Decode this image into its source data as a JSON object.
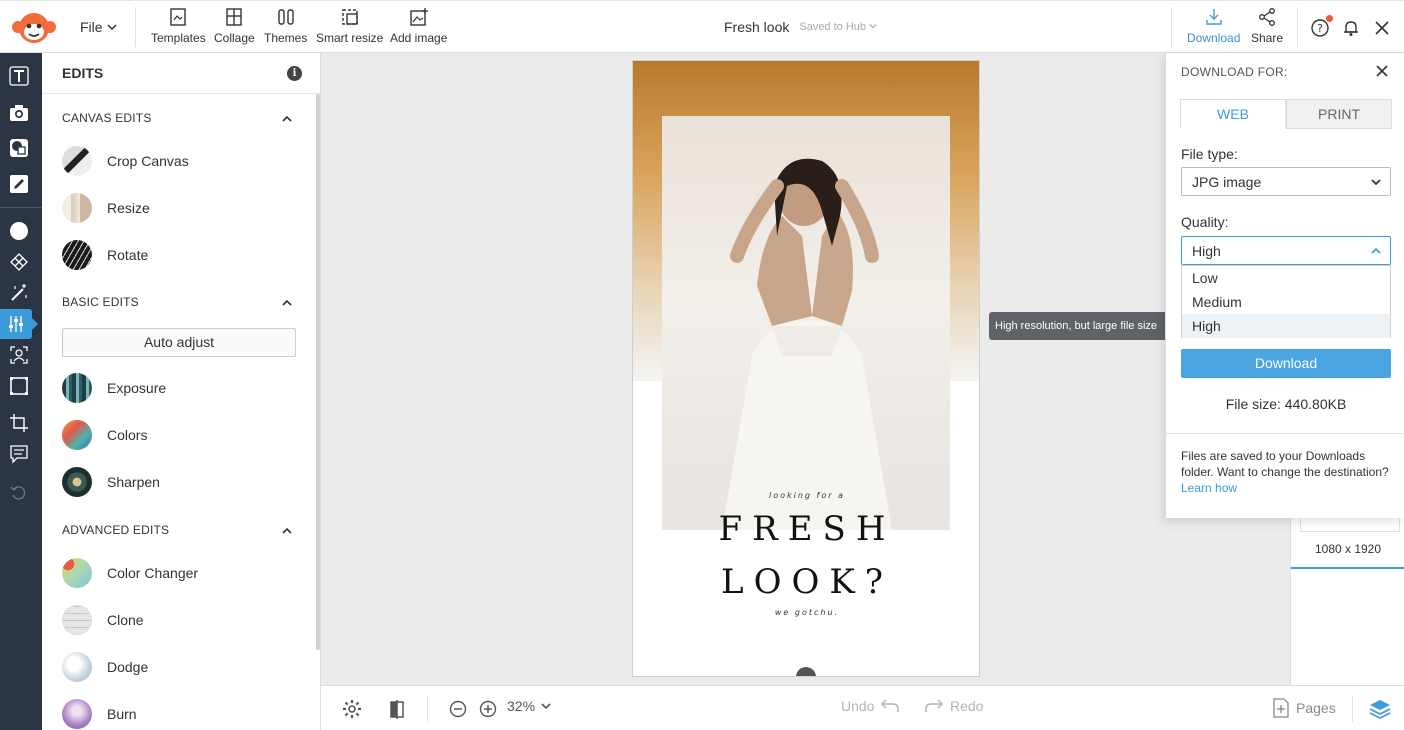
{
  "topbar": {
    "file_label": "File",
    "tools": [
      {
        "icon": "templates-icon",
        "label": "Templates"
      },
      {
        "icon": "collage-icon",
        "label": "Collage"
      },
      {
        "icon": "themes-icon",
        "label": "Themes"
      },
      {
        "icon": "smart-resize-icon",
        "label": "Smart resize"
      },
      {
        "icon": "add-image-icon",
        "label": "Add image"
      }
    ],
    "doc_title": "Fresh look",
    "saved_status": "Saved to Hub",
    "download_label": "Download",
    "share_label": "Share",
    "accent_color": "#3b9cdc",
    "notification_color": "#f0563a"
  },
  "rail": {
    "items": [
      "text-icon",
      "camera-icon",
      "shapes-icon",
      "draw-icon",
      "circle-icon",
      "texture-icon",
      "magic-wand-icon",
      "adjust-sliders-icon",
      "face-icon",
      "frame-icon",
      "crop-icon",
      "comment-icon",
      "undo-icon"
    ],
    "active": "adjust-sliders-icon"
  },
  "panel": {
    "title": "EDITS",
    "sections": {
      "canvas": {
        "title": "CANVAS EDITS",
        "items": [
          "Crop Canvas",
          "Resize",
          "Rotate"
        ]
      },
      "basic": {
        "title": "BASIC EDITS",
        "auto_adjust": "Auto adjust",
        "items": [
          "Exposure",
          "Colors",
          "Sharpen"
        ]
      },
      "advanced": {
        "title": "ADVANCED EDITS",
        "items": [
          "Color Changer",
          "Clone",
          "Dodge",
          "Burn"
        ]
      }
    }
  },
  "poster": {
    "line1": "looking for a",
    "line2": "FRESH",
    "line3": "LOOK?",
    "line4": "we gotchu."
  },
  "tooltip": "High resolution, but large file size",
  "download_panel": {
    "heading": "DOWNLOAD FOR:",
    "tabs": [
      "WEB",
      "PRINT"
    ],
    "active_tab": "WEB",
    "file_type_label": "File type:",
    "file_type_value": "JPG image",
    "quality_label": "Quality:",
    "quality_value": "High",
    "quality_options": [
      "Low",
      "Medium",
      "High"
    ],
    "download_button": "Download",
    "file_size": "File size: 440.80KB",
    "note": "Files are saved to your Downloads folder. Want to change the destination?",
    "learn_how": "Learn how"
  },
  "right_strip": {
    "size": "1080 x 1920"
  },
  "bottombar": {
    "zoom": "32%",
    "undo": "Undo",
    "redo": "Redo",
    "pages": "Pages"
  }
}
